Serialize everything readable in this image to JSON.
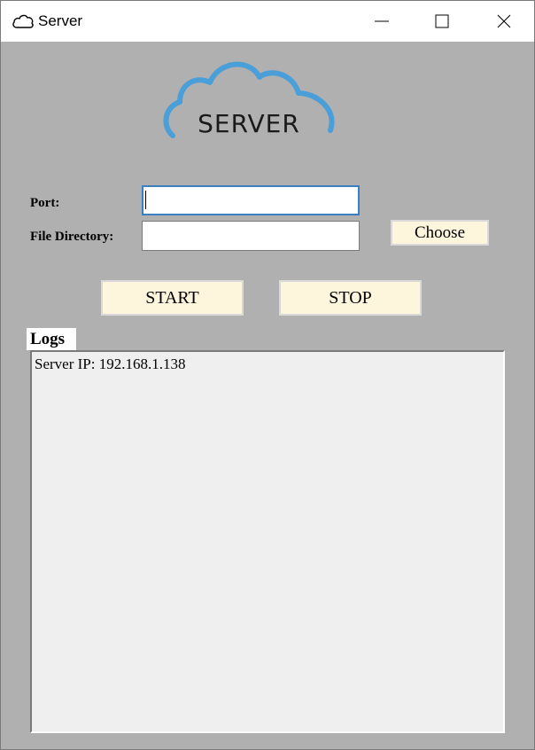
{
  "window": {
    "title": "Server",
    "icon": "cloud-icon",
    "controls": [
      "minimize-icon",
      "maximize-icon",
      "close-icon"
    ]
  },
  "logo": {
    "text": "SERVER",
    "icon": "cloud-icon",
    "color": "#4a9fd8"
  },
  "form": {
    "port_label": "Port:",
    "port_value": "",
    "dir_label": "File Directory:",
    "dir_value": "",
    "choose_label": "Choose"
  },
  "actions": {
    "start_label": "START",
    "stop_label": "STOP"
  },
  "logs": {
    "label": "Logs",
    "lines": [
      "Server IP: 192.168.1.138"
    ]
  },
  "colors": {
    "background": "#b0b0b0",
    "button_fill": "#fdf5dc",
    "focus_border": "#3a7fc4"
  }
}
